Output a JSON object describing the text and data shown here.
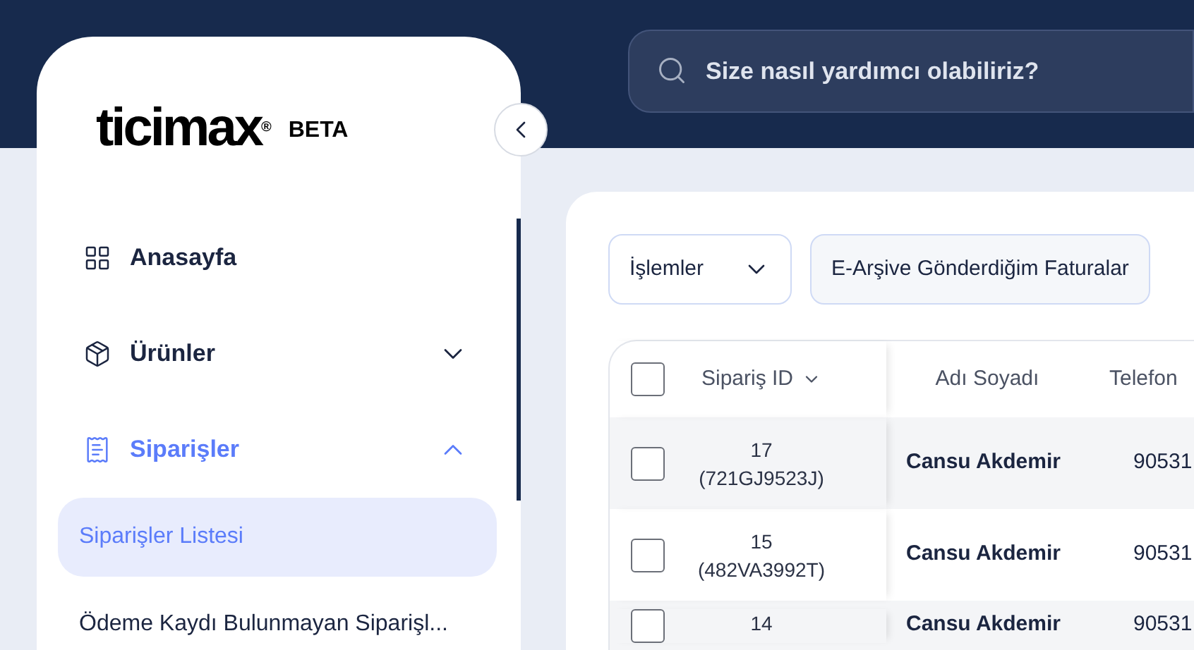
{
  "header": {
    "search": {
      "placeholder": "Size nasıl yardımcı olabiliriz?"
    }
  },
  "sidebar": {
    "logo": {
      "wordmark": "ticimax",
      "registered": "®",
      "badge": "BETA"
    },
    "items": [
      {
        "kind": "link",
        "label": "Anasayfa",
        "selected": false
      },
      {
        "kind": "group",
        "label": "Ürünler",
        "selected": false,
        "expanded": false
      },
      {
        "kind": "group",
        "label": "Siparişler",
        "selected": true,
        "expanded": true,
        "children": [
          {
            "label": "Siparişler Listesi",
            "selected": true
          },
          {
            "label": "Ödeme Kaydı Bulunmayan Siparişl...",
            "selected": false
          }
        ]
      }
    ]
  },
  "toolbar": {
    "actions_dropdown": "İşlemler",
    "filter_button": "E-Arşive Gönderdiğim Faturalar"
  },
  "table": {
    "select_all": {
      "checked": false
    },
    "columns": [
      {
        "label": "Sipariş ID",
        "sortable": true
      },
      {
        "label": "Adı Soyadı",
        "sortable": false
      },
      {
        "label": "Telefon",
        "sortable": false
      }
    ],
    "rows": [
      {
        "checked": false,
        "id": "17",
        "code": "(721GJ9523J)",
        "name": "Cansu Akdemir",
        "phone": "90531"
      },
      {
        "checked": false,
        "id": "15",
        "code": "(482VA3992T)",
        "name": "Cansu Akdemir",
        "phone": "90531"
      },
      {
        "checked": false,
        "id": "14",
        "name": "Cansu Akdemir",
        "phone": "90531"
      }
    ]
  }
}
